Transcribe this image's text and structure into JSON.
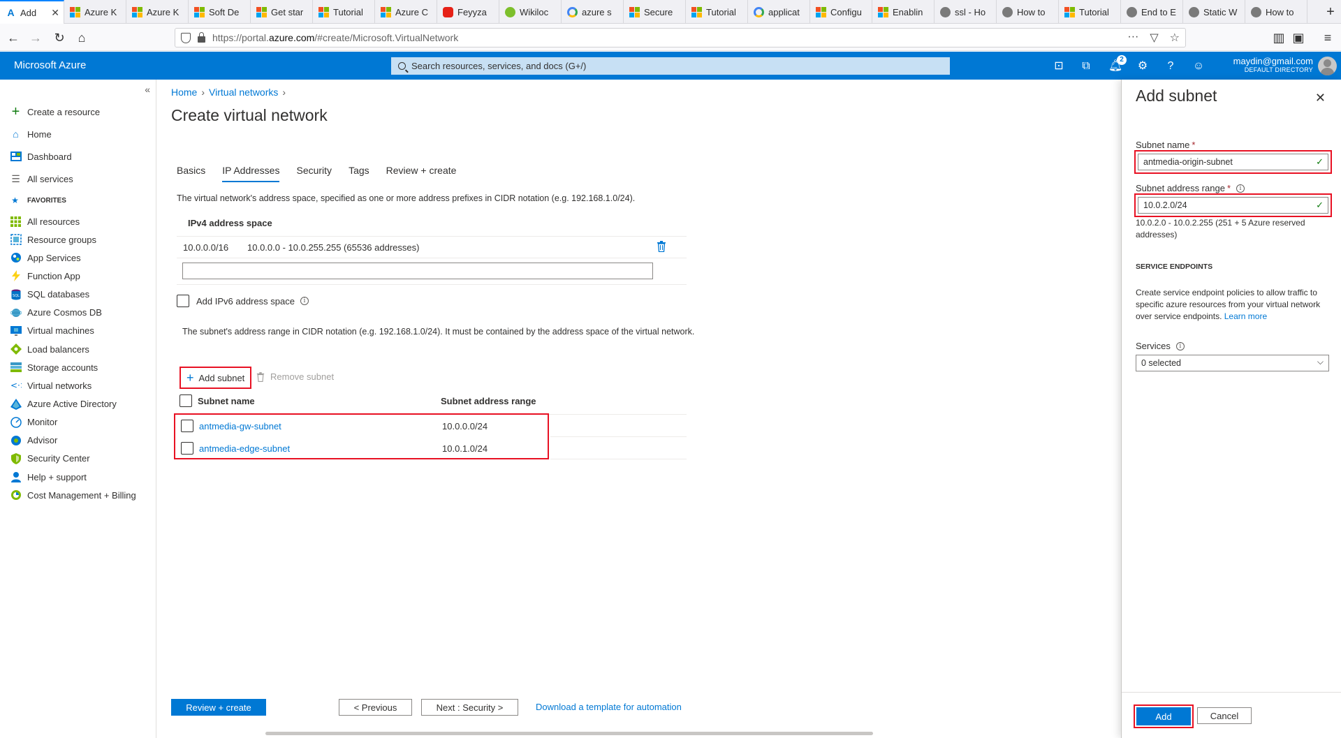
{
  "browser": {
    "tabs": [
      {
        "label": "Add",
        "icon": "azure-icon",
        "active": true
      },
      {
        "label": "Azure K",
        "icon": "microsoft-icon"
      },
      {
        "label": "Azure K",
        "icon": "microsoft-icon"
      },
      {
        "label": "Soft De",
        "icon": "microsoft-icon"
      },
      {
        "label": "Get star",
        "icon": "microsoft-icon"
      },
      {
        "label": "Tutorial",
        "icon": "microsoft-icon"
      },
      {
        "label": "Azure C",
        "icon": "microsoft-icon"
      },
      {
        "label": "Feyyza",
        "icon": "youtube-icon"
      },
      {
        "label": "Wikiloc",
        "icon": "wikiloc-icon"
      },
      {
        "label": "azure s",
        "icon": "google-icon"
      },
      {
        "label": "Secure",
        "icon": "microsoft-icon"
      },
      {
        "label": "Tutorial",
        "icon": "microsoft-icon"
      },
      {
        "label": "applicat",
        "icon": "google-icon"
      },
      {
        "label": "Configu",
        "icon": "microsoft-icon"
      },
      {
        "label": "Enablin",
        "icon": "microsoft-icon"
      },
      {
        "label": "ssl - Ho",
        "icon": "stackoverflow-icon"
      },
      {
        "label": "How to",
        "icon": "generic-icon"
      },
      {
        "label": "Tutorial",
        "icon": "microsoft-icon"
      },
      {
        "label": "End to E",
        "icon": "generic-icon"
      },
      {
        "label": "Static W",
        "icon": "generic-icon"
      },
      {
        "label": "How to",
        "icon": "generic-icon"
      }
    ],
    "new_tab": "+",
    "url_prefix": "https://portal.",
    "url_domain": "azure.com",
    "url_suffix": "/#create/Microsoft.VirtualNetwork",
    "url_menu": "···"
  },
  "azure": {
    "brand": "Microsoft Azure",
    "search_placeholder": "Search resources, services, and docs (G+/)",
    "notifications_count": "2",
    "user_email": "maydin@gmail.com",
    "user_directory": "DEFAULT DIRECTORY"
  },
  "leftnav": {
    "collapse": "«",
    "create": "Create a resource",
    "home": "Home",
    "dashboard": "Dashboard",
    "all_services": "All services",
    "favorites_label": "FAVORITES",
    "items": [
      "All resources",
      "Resource groups",
      "App Services",
      "Function App",
      "SQL databases",
      "Azure Cosmos DB",
      "Virtual machines",
      "Load balancers",
      "Storage accounts",
      "Virtual networks",
      "Azure Active Directory",
      "Monitor",
      "Advisor",
      "Security Center",
      "Help + support",
      "Cost Management + Billing"
    ]
  },
  "main": {
    "breadcrumb": [
      "Home",
      "Virtual networks"
    ],
    "title": "Create virtual network",
    "tabs": [
      "Basics",
      "IP Addresses",
      "Security",
      "Tags",
      "Review + create"
    ],
    "active_tab": "IP Addresses",
    "address_space_desc": "The virtual network's address space, specified as one or more address prefixes in CIDR notation (e.g. 192.168.1.0/24).",
    "ipv4_header": "IPv4 address space",
    "ipv4_prefix": "10.0.0.0/16",
    "ipv4_range": "10.0.0.0 - 10.0.255.255 (65536 addresses)",
    "ipv6_label": "Add IPv6 address space",
    "subnet_desc": "The subnet's address range in CIDR notation (e.g. 192.168.1.0/24). It must be contained by the address space of the virtual network.",
    "add_subnet": "Add subnet",
    "remove_subnet": "Remove subnet",
    "col_name": "Subnet name",
    "col_range": "Subnet address range",
    "subnets": [
      {
        "name": "antmedia-gw-subnet",
        "range": "10.0.0.0/24"
      },
      {
        "name": "antmedia-edge-subnet",
        "range": "10.0.1.0/24"
      }
    ],
    "review_create": "Review + create",
    "previous": "< Previous",
    "next": "Next : Security >",
    "download_template": "Download a template for automation"
  },
  "panel": {
    "title": "Add subnet",
    "name_label": "Subnet name",
    "name_value": "antmedia-origin-subnet",
    "range_label": "Subnet address range",
    "range_value": "10.0.2.0/24",
    "range_hint": "10.0.2.0 - 10.0.2.255 (251 + 5 Azure reserved addresses)",
    "endpoints_header": "SERVICE ENDPOINTS",
    "endpoints_desc": "Create service endpoint policies to allow traffic to specific azure resources from your virtual network over service endpoints.",
    "learn_more": "Learn more",
    "services_label": "Services",
    "services_value": "0 selected",
    "add": "Add",
    "cancel": "Cancel",
    "required_mark": "*"
  }
}
